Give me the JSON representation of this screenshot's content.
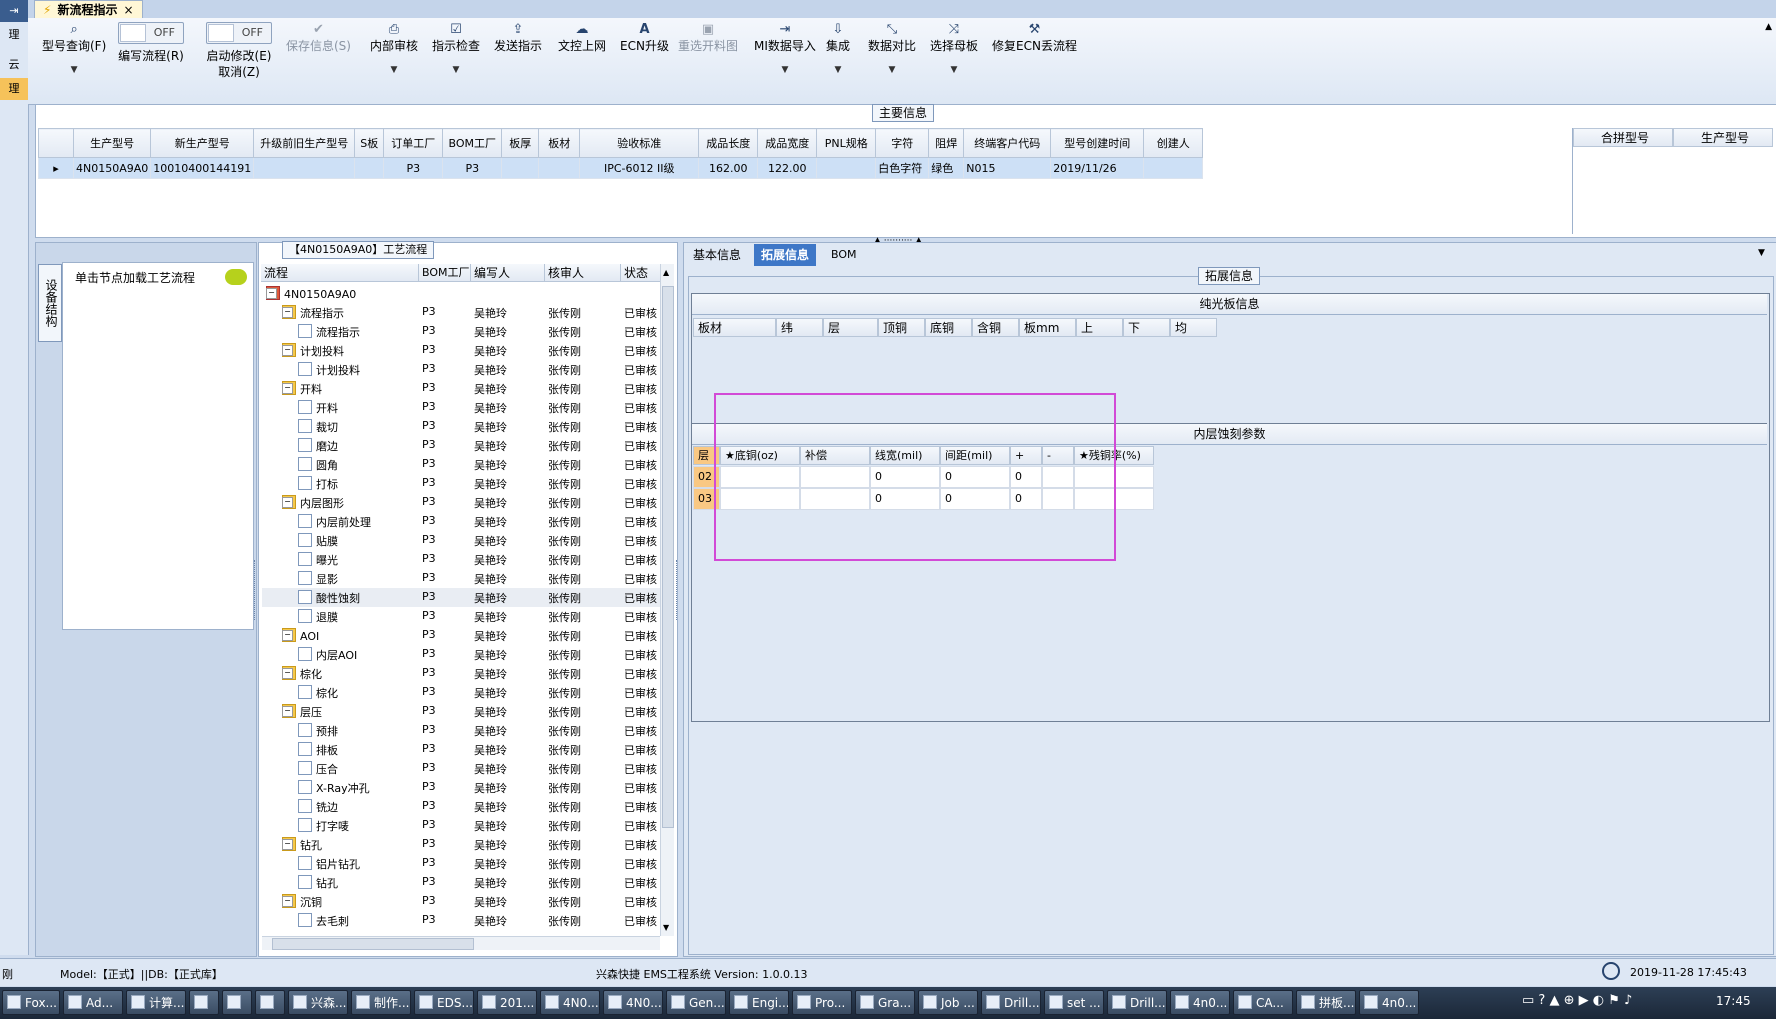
{
  "window": {
    "doc_tab": "新流程指示",
    "close": "×"
  },
  "edge_items": [
    "理",
    "云",
    "理"
  ],
  "toolbar": [
    {
      "label": "型号查询(F)",
      "icon": "search-icon",
      "glyph": "🔍"
    },
    {
      "label": "编写流程(R)",
      "toggle": "OFF"
    },
    {
      "label": "启动修改(E)",
      "label2": "取消(Z)",
      "toggle": "OFF"
    },
    {
      "label": "保存信息(S)",
      "icon": "check-icon",
      "glyph": "✔",
      "disabled": true
    },
    {
      "label": "内部审核",
      "icon": "printer-icon",
      "glyph": "⎙"
    },
    {
      "label": "指示检查",
      "icon": "checkbox-icon",
      "glyph": "☑"
    },
    {
      "label": "发送指示",
      "icon": "upload-icon",
      "glyph": "⇪"
    },
    {
      "label": "文控上网",
      "icon": "cloud-upload-icon",
      "glyph": "☁"
    },
    {
      "label": "ECN升级",
      "icon": "font-icon",
      "glyph": "A"
    },
    {
      "label": "重选开料图",
      "icon": "image-icon",
      "glyph": "▣",
      "disabled": true
    },
    {
      "label": "MI数据导入",
      "icon": "import-icon",
      "glyph": "⇥"
    },
    {
      "label": "集成",
      "icon": "download-icon",
      "glyph": "⇩"
    },
    {
      "label": "数据对比",
      "icon": "compare-icon",
      "glyph": "⤡"
    },
    {
      "label": "选择母板",
      "icon": "shuffle-icon",
      "glyph": "⤨"
    },
    {
      "label": "修复ECN丢流程",
      "icon": "wrench-icon",
      "glyph": "🔧"
    }
  ],
  "main_info": {
    "caption": "主要信息",
    "columns": [
      "生产型号",
      "新生产型号",
      "升级前旧生产型号",
      "S板",
      "订单工厂",
      "BOM工厂",
      "板厚",
      "板材",
      "验收标准",
      "成品长度",
      "成品宽度",
      "PNL规格",
      "字符",
      "阻焊",
      "终端客户代码",
      "型号创建时间",
      "创建人"
    ],
    "row": [
      "4N0150A9A0",
      "10010400144191",
      "",
      "",
      "P3",
      "P3",
      "",
      "",
      "IPC-6012 II级",
      "162.00",
      "122.00",
      "",
      "白色字符",
      "绿色",
      "N015",
      "2019/11/26",
      ""
    ],
    "side_columns": [
      "合拼型号",
      "生产型号"
    ]
  },
  "left_panel": {
    "vertical_tab": "设备结构",
    "node_hint": "单击节点加载工艺流程"
  },
  "flow": {
    "caption": "【4N0150A9A0】工艺流程",
    "columns": [
      "流程",
      "BOM工厂",
      "编写人",
      "核审人",
      "状态"
    ],
    "rows": [
      {
        "level": 0,
        "name": "4N0150A9A0",
        "type": "home",
        "bom": "",
        "writer": "",
        "reviewer": "",
        "status": ""
      },
      {
        "level": 1,
        "name": "流程指示",
        "type": "folder",
        "bom": "P3",
        "writer": "吴艳玲",
        "reviewer": "张传刚",
        "status": "已审核"
      },
      {
        "level": 2,
        "name": "流程指示",
        "type": "doc",
        "bom": "P3",
        "writer": "吴艳玲",
        "reviewer": "张传刚",
        "status": "已审核"
      },
      {
        "level": 1,
        "name": "计划投料",
        "type": "folder",
        "bom": "P3",
        "writer": "吴艳玲",
        "reviewer": "张传刚",
        "status": "已审核"
      },
      {
        "level": 2,
        "name": "计划投料",
        "type": "doc",
        "bom": "P3",
        "writer": "吴艳玲",
        "reviewer": "张传刚",
        "status": "已审核"
      },
      {
        "level": 1,
        "name": "开料",
        "type": "folder",
        "bom": "P3",
        "writer": "吴艳玲",
        "reviewer": "张传刚",
        "status": "已审核"
      },
      {
        "level": 2,
        "name": "开料",
        "type": "doc",
        "bom": "P3",
        "writer": "吴艳玲",
        "reviewer": "张传刚",
        "status": "已审核"
      },
      {
        "level": 2,
        "name": "裁切",
        "type": "doc",
        "bom": "P3",
        "writer": "吴艳玲",
        "reviewer": "张传刚",
        "status": "已审核"
      },
      {
        "level": 2,
        "name": "磨边",
        "type": "doc",
        "bom": "P3",
        "writer": "吴艳玲",
        "reviewer": "张传刚",
        "status": "已审核"
      },
      {
        "level": 2,
        "name": "圆角",
        "type": "doc",
        "bom": "P3",
        "writer": "吴艳玲",
        "reviewer": "张传刚",
        "status": "已审核"
      },
      {
        "level": 2,
        "name": "打标",
        "type": "doc",
        "bom": "P3",
        "writer": "吴艳玲",
        "reviewer": "张传刚",
        "status": "已审核"
      },
      {
        "level": 1,
        "name": "内层图形",
        "type": "folder",
        "bom": "P3",
        "writer": "吴艳玲",
        "reviewer": "张传刚",
        "status": "已审核"
      },
      {
        "level": 2,
        "name": "内层前处理",
        "type": "doc",
        "bom": "P3",
        "writer": "吴艳玲",
        "reviewer": "张传刚",
        "status": "已审核"
      },
      {
        "level": 2,
        "name": "贴膜",
        "type": "doc",
        "bom": "P3",
        "writer": "吴艳玲",
        "reviewer": "张传刚",
        "status": "已审核"
      },
      {
        "level": 2,
        "name": "曝光",
        "type": "doc",
        "bom": "P3",
        "writer": "吴艳玲",
        "reviewer": "张传刚",
        "status": "已审核"
      },
      {
        "level": 2,
        "name": "显影",
        "type": "doc",
        "bom": "P3",
        "writer": "吴艳玲",
        "reviewer": "张传刚",
        "status": "已审核"
      },
      {
        "level": 2,
        "name": "酸性蚀刻",
        "type": "doc",
        "bom": "P3",
        "writer": "吴艳玲",
        "reviewer": "张传刚",
        "status": "已审核",
        "selected": true
      },
      {
        "level": 2,
        "name": "退膜",
        "type": "doc",
        "bom": "P3",
        "writer": "吴艳玲",
        "reviewer": "张传刚",
        "status": "已审核"
      },
      {
        "level": 1,
        "name": "AOI",
        "type": "folder",
        "bom": "P3",
        "writer": "吴艳玲",
        "reviewer": "张传刚",
        "status": "已审核"
      },
      {
        "level": 2,
        "name": "内层AOI",
        "type": "doc",
        "bom": "P3",
        "writer": "吴艳玲",
        "reviewer": "张传刚",
        "status": "已审核"
      },
      {
        "level": 1,
        "name": "棕化",
        "type": "folder",
        "bom": "P3",
        "writer": "吴艳玲",
        "reviewer": "张传刚",
        "status": "已审核"
      },
      {
        "level": 2,
        "name": "棕化",
        "type": "doc",
        "bom": "P3",
        "writer": "吴艳玲",
        "reviewer": "张传刚",
        "status": "已审核"
      },
      {
        "level": 1,
        "name": "层压",
        "type": "folder",
        "bom": "P3",
        "writer": "吴艳玲",
        "reviewer": "张传刚",
        "status": "已审核"
      },
      {
        "level": 2,
        "name": "预排",
        "type": "doc",
        "bom": "P3",
        "writer": "吴艳玲",
        "reviewer": "张传刚",
        "status": "已审核"
      },
      {
        "level": 2,
        "name": "排板",
        "type": "doc",
        "bom": "P3",
        "writer": "吴艳玲",
        "reviewer": "张传刚",
        "status": "已审核"
      },
      {
        "level": 2,
        "name": "压合",
        "type": "doc",
        "bom": "P3",
        "writer": "吴艳玲",
        "reviewer": "张传刚",
        "status": "已审核"
      },
      {
        "level": 2,
        "name": "X-Ray冲孔",
        "type": "doc",
        "bom": "P3",
        "writer": "吴艳玲",
        "reviewer": "张传刚",
        "status": "已审核"
      },
      {
        "level": 2,
        "name": "铣边",
        "type": "doc",
        "bom": "P3",
        "writer": "吴艳玲",
        "reviewer": "张传刚",
        "status": "已审核"
      },
      {
        "level": 2,
        "name": "打字唛",
        "type": "doc",
        "bom": "P3",
        "writer": "吴艳玲",
        "reviewer": "张传刚",
        "status": "已审核"
      },
      {
        "level": 1,
        "name": "钻孔",
        "type": "folder",
        "bom": "P3",
        "writer": "吴艳玲",
        "reviewer": "张传刚",
        "status": "已审核"
      },
      {
        "level": 2,
        "name": "铝片钻孔",
        "type": "doc",
        "bom": "P3",
        "writer": "吴艳玲",
        "reviewer": "张传刚",
        "status": "已审核"
      },
      {
        "level": 2,
        "name": "钻孔",
        "type": "doc",
        "bom": "P3",
        "writer": "吴艳玲",
        "reviewer": "张传刚",
        "status": "已审核"
      },
      {
        "level": 1,
        "name": "沉铜",
        "type": "folder",
        "bom": "P3",
        "writer": "吴艳玲",
        "reviewer": "张传刚",
        "status": "已审核"
      },
      {
        "level": 2,
        "name": "去毛刺",
        "type": "doc",
        "bom": "P3",
        "writer": "吴艳玲",
        "reviewer": "张传刚",
        "status": "已审核"
      }
    ]
  },
  "right": {
    "tabs": [
      "基本信息",
      "拓展信息",
      "BOM"
    ],
    "ext_caption": "拓展信息",
    "plain_board": {
      "title": "纯光板信息",
      "columns": [
        "板材",
        "纬",
        "层",
        "顶铜",
        "底铜",
        "含铜",
        "板mm",
        "上",
        "下",
        "均"
      ]
    },
    "inner_etch": {
      "title": "内层蚀刻参数",
      "columns": [
        "层",
        "★底铜(oz)",
        "补偿",
        "线宽(mil)",
        "间距(mil)",
        "+",
        "-",
        "★残铜率(%)"
      ],
      "rows": [
        [
          "02",
          "",
          "",
          "0",
          "0",
          "0",
          "",
          ""
        ],
        [
          "03",
          "",
          "",
          "0",
          "0",
          "0",
          "",
          ""
        ]
      ]
    }
  },
  "status": {
    "left": "刚",
    "model": "Model:【正式】||DB:【正式库】",
    "center": "兴森快捷 EMS工程系统 Version: 1.0.0.13",
    "datetime": "2019-11-28 17:45:43"
  },
  "taskbar": {
    "items": [
      "Fox...",
      "Ad...",
      "计算...",
      "",
      "",
      "",
      "兴森...",
      "制作...",
      "EDS...",
      "201...",
      "4N0...",
      "4N0...",
      "Gen...",
      "Engi...",
      "Pro...",
      "Gra...",
      "Job ...",
      "Drill...",
      "set ...",
      "Drill...",
      "4n0...",
      "CA...",
      "拼板...",
      "4n0..."
    ],
    "clock": "17:45"
  },
  "colors": {
    "accent": "#3e77c7",
    "highlight": "#d24ad6",
    "row_header": "#f9c883"
  }
}
